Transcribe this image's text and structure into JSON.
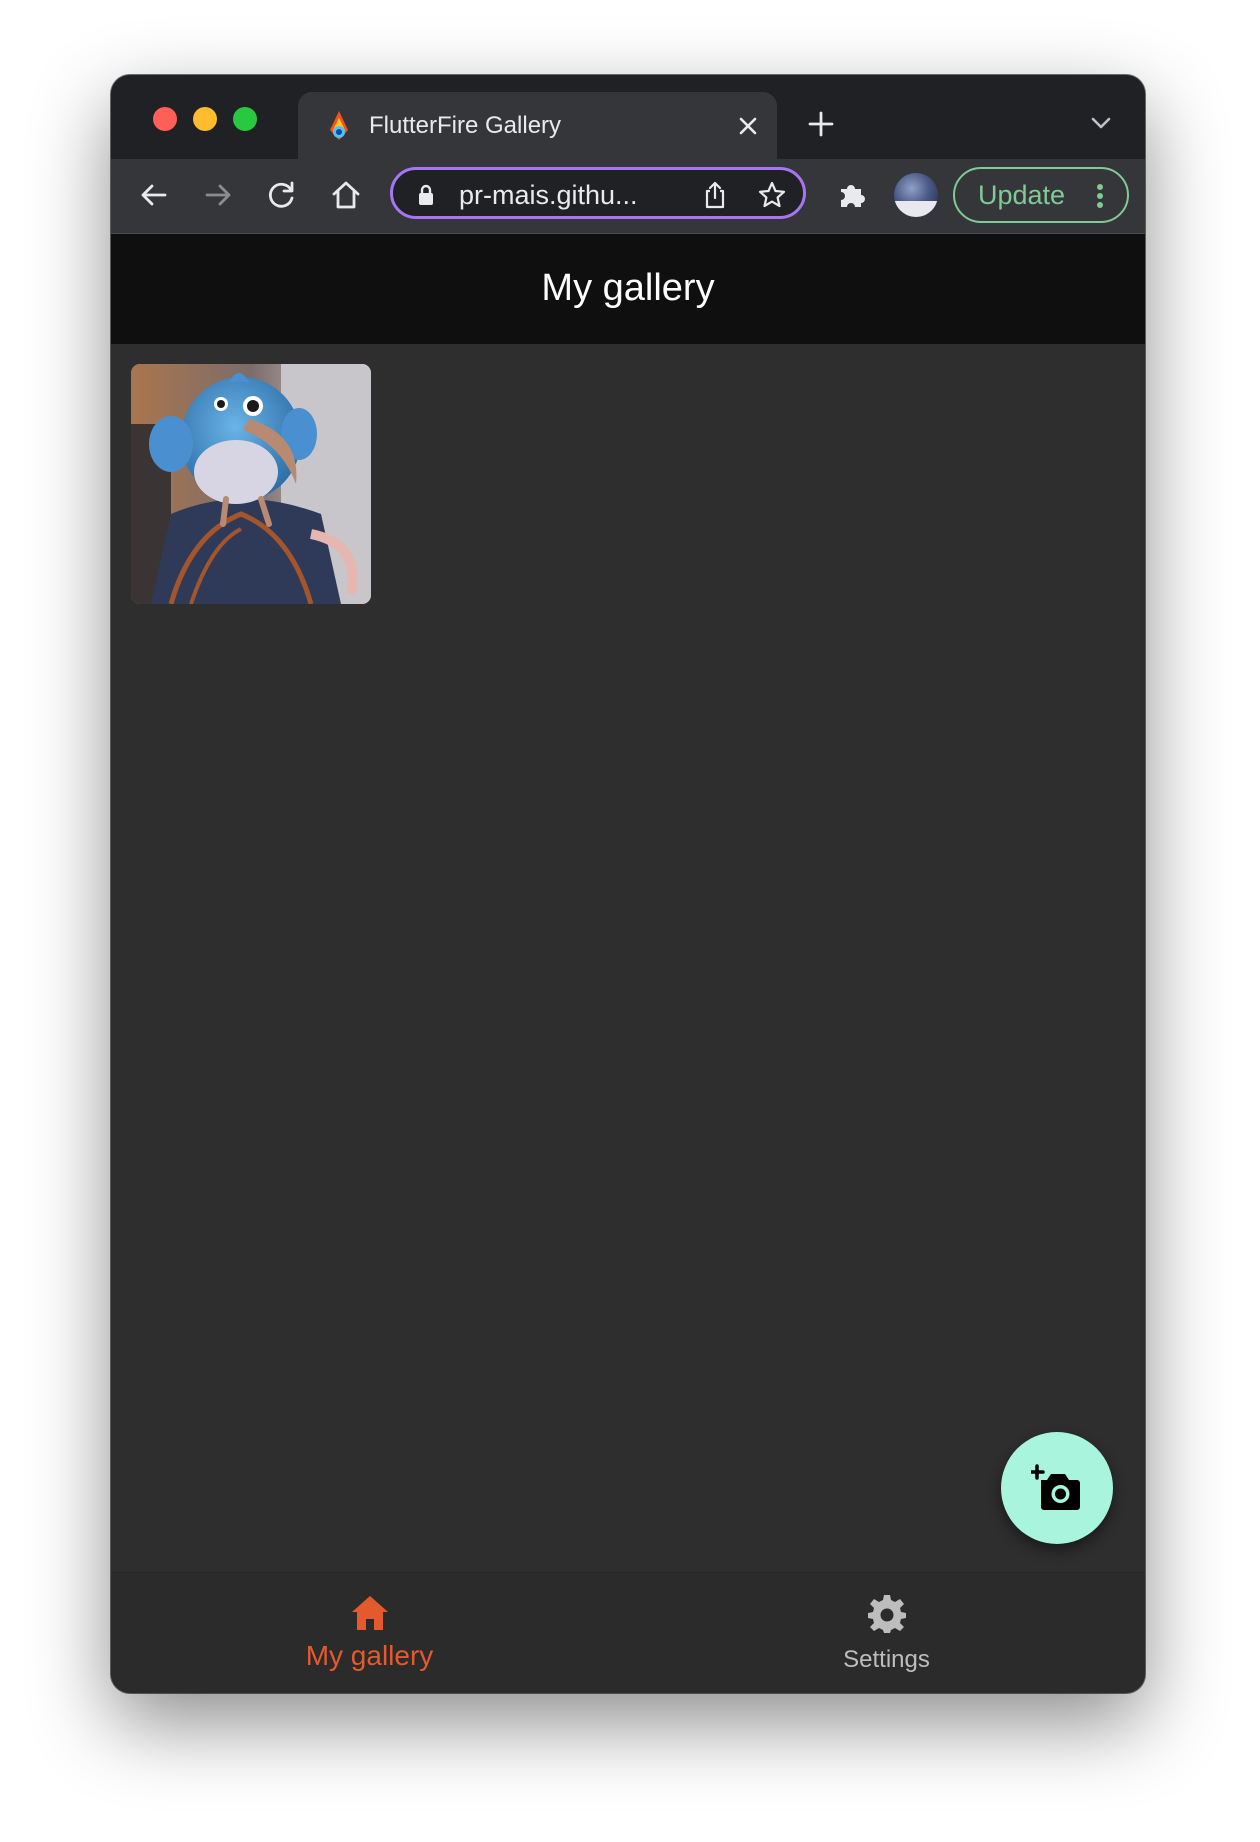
{
  "browser": {
    "tab": {
      "title": "FlutterFire Gallery",
      "favicon": "flutterfire-favicon"
    },
    "address_bar": {
      "url": "pr-mais.githu..."
    },
    "update_button": {
      "label": "Update"
    },
    "icons": [
      "back-icon",
      "forward-icon",
      "reload-icon",
      "home-icon",
      "lock-icon",
      "share-icon",
      "star-icon",
      "extensions-icon",
      "new-tab-icon",
      "tab-menu-icon",
      "close-icon"
    ]
  },
  "app": {
    "appbar": {
      "title": "My gallery"
    },
    "gallery": {
      "images": [
        {
          "alt": "plush bird toy photo"
        }
      ]
    },
    "fab": {
      "icon": "add-photo-camera-icon",
      "color": "#a9f4dc"
    },
    "bottom_nav": {
      "items": [
        {
          "label": "My gallery",
          "icon": "home-icon",
          "active": true
        },
        {
          "label": "Settings",
          "icon": "settings-gear-icon",
          "active": false
        }
      ],
      "active_color": "#e45a2d"
    }
  }
}
